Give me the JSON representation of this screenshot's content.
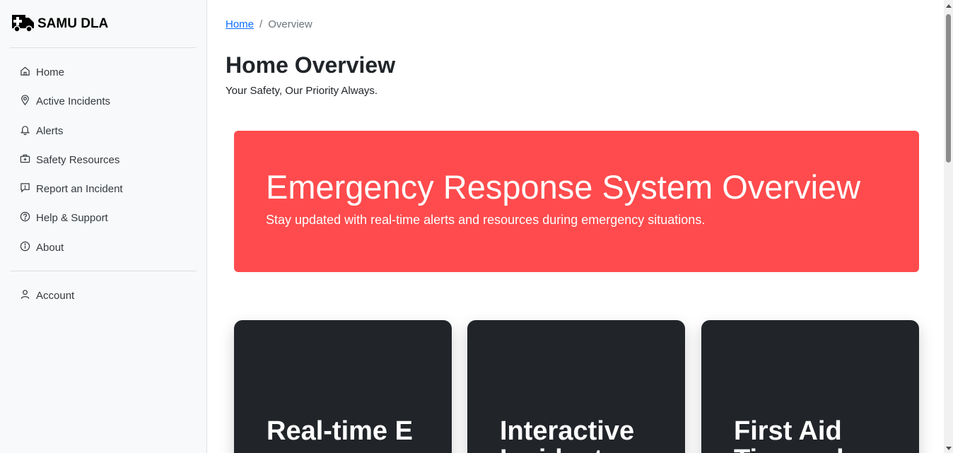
{
  "brand": {
    "name": "SAMU DLA",
    "icon": "ambulance-icon"
  },
  "sidebar": {
    "items": [
      {
        "label": "Home",
        "icon": "house-icon"
      },
      {
        "label": "Active Incidents",
        "icon": "map-pin-icon"
      },
      {
        "label": "Alerts",
        "icon": "bell-icon"
      },
      {
        "label": "Safety Resources",
        "icon": "first-aid-kit-icon"
      },
      {
        "label": "Report an Incident",
        "icon": "chat-square-icon"
      },
      {
        "label": "Help & Support",
        "icon": "question-circle-icon"
      },
      {
        "label": "About",
        "icon": "info-circle-icon"
      }
    ],
    "account": {
      "label": "Account",
      "icon": "person-icon"
    }
  },
  "breadcrumb": {
    "home": "Home",
    "separator": "/",
    "current": "Overview"
  },
  "page": {
    "title": "Home Overview",
    "subtitle": "Your Safety, Our Priority Always."
  },
  "hero": {
    "title": "Emergency Response System Overview",
    "subtitle": "Stay updated with real-time alerts and resources during emergency situations.",
    "color": "#ff4b4d"
  },
  "cards": [
    {
      "title": "Real-time E"
    },
    {
      "title": "Interactive Incident"
    },
    {
      "title": "First Aid Tips and"
    }
  ]
}
